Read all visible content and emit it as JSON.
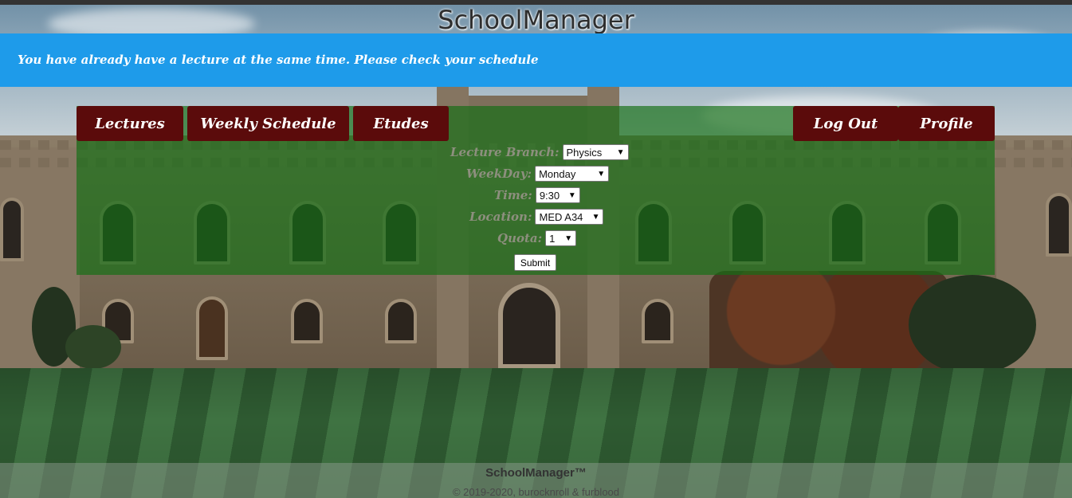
{
  "app": {
    "title": "SchoolManager"
  },
  "alert": {
    "message": "You have already have a lecture at the same time. Please check your schedule"
  },
  "nav": {
    "lectures": "Lectures",
    "weekly_schedule": "Weekly Schedule",
    "etudes": "Etudes",
    "log_out": "Log Out",
    "profile": "Profile"
  },
  "form": {
    "branch": {
      "label": "Lecture Branch:",
      "value": "Physics"
    },
    "weekday": {
      "label": "WeekDay:",
      "value": "Monday"
    },
    "time": {
      "label": "Time:",
      "value": "9:30"
    },
    "location": {
      "label": "Location:",
      "value": "MED A34"
    },
    "quota": {
      "label": "Quota:",
      "value": "1"
    },
    "submit_label": "Submit"
  },
  "footer": {
    "brand": "SchoolManager™",
    "copyright": "© 2019-2020, burocknroll & furblood"
  },
  "colors": {
    "alert_bg": "#1e9bea",
    "nav_bg": "#5b0b0b",
    "panel_bg": "rgba(20,110,20,0.68)"
  }
}
